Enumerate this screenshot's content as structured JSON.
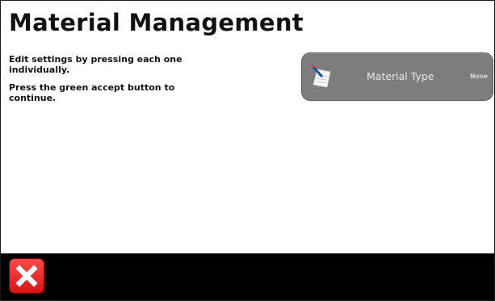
{
  "header": {
    "title": "Material Management"
  },
  "instructions": {
    "line1": "Edit settings by pressing each one individually.",
    "line2": "Press the green accept button to continue."
  },
  "settings": [
    {
      "label": "Material Type",
      "value": "None",
      "icon": "notepad-pen-icon"
    }
  ],
  "footer": {
    "cancel_icon": "close-icon",
    "cancel_color": "#e52222",
    "bar_color": "#000000"
  }
}
